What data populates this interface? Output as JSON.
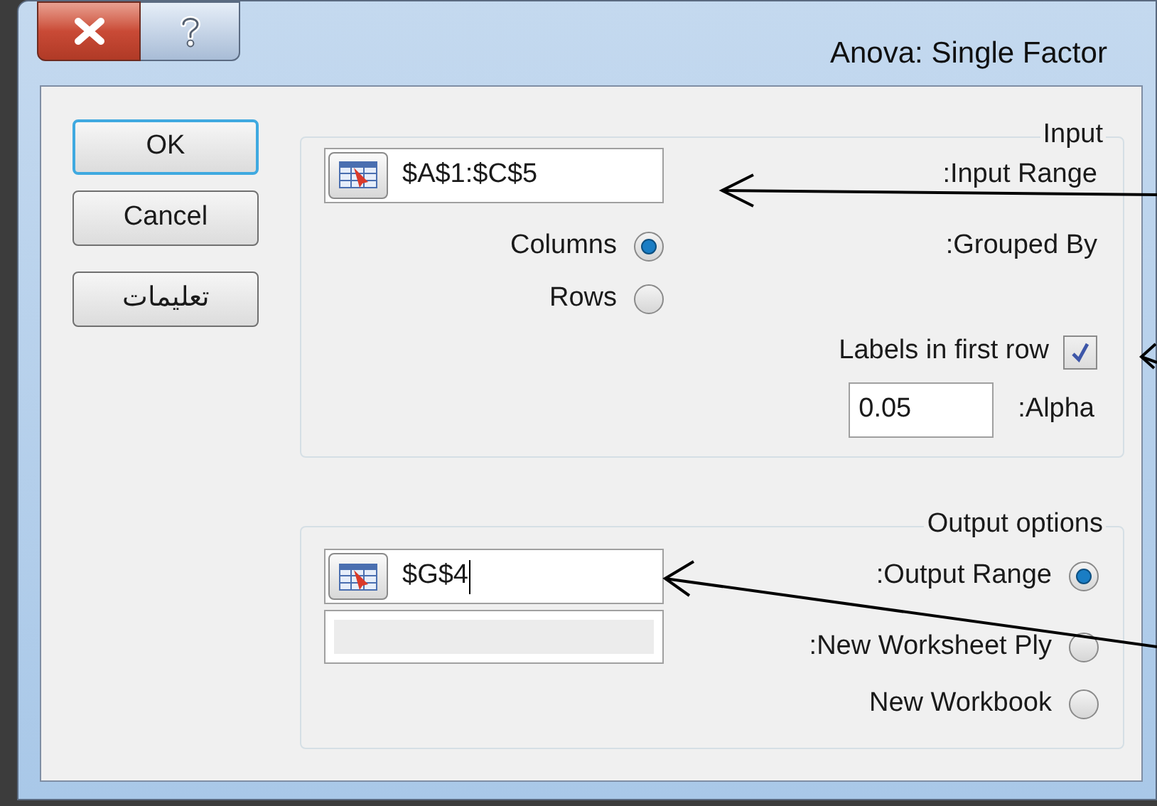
{
  "window": {
    "title": "Anova: Single Factor"
  },
  "buttons": [
    {
      "label": "OK",
      "default": true
    },
    {
      "label": "Cancel",
      "default": false
    },
    {
      "label": "تعليمات",
      "default": false
    }
  ],
  "input": {
    "legend": "Input",
    "input_range": {
      "label": ":Input Range",
      "value": "$A$1:$C$5"
    },
    "grouped_by": {
      "label": ":Grouped By",
      "options": [
        {
          "label": "Columns",
          "selected": true
        },
        {
          "label": "Rows",
          "selected": false
        }
      ]
    },
    "labels_in_first_row": {
      "label": "Labels in first row",
      "checked": true
    },
    "alpha": {
      "label": ":Alpha",
      "value": "0.05"
    }
  },
  "output": {
    "legend": "Output options",
    "options": [
      {
        "label": ":Output Range",
        "selected": true
      },
      {
        "label": ":New Worksheet Ply",
        "selected": false
      },
      {
        "label": "New Workbook",
        "selected": false
      }
    ],
    "output_range_field": {
      "value": "$G$4",
      "focused": true
    },
    "sheet_name_field": {
      "disabled": true
    }
  }
}
